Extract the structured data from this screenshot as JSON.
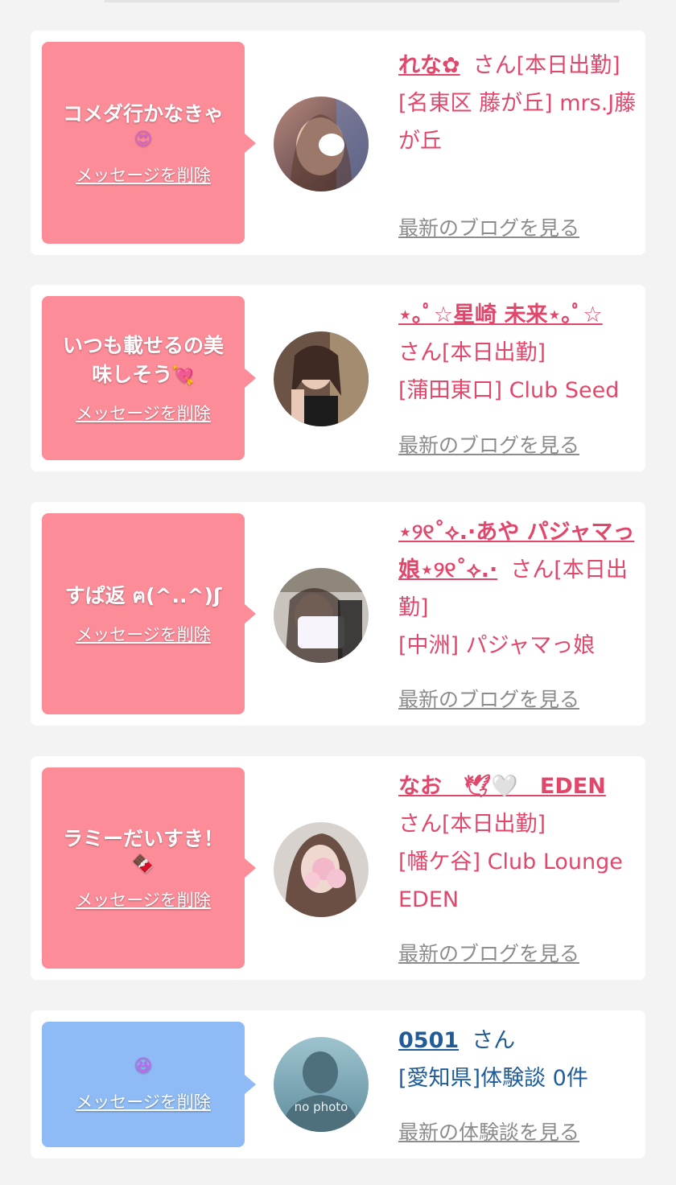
{
  "cards": [
    {
      "message": "コメダ行かなきゃ",
      "message_emoji": "😍",
      "delete_label": "メッセージを削除",
      "name": "れな✿",
      "suffix": "さん[本日出勤]",
      "shop": "[名東区 藤が丘] mrs.J藤が丘",
      "blog_label": "最新のブログを見る"
    },
    {
      "message": "いつも載せるの美味しそう",
      "message_emoji": "💘",
      "delete_label": "メッセージを削除",
      "name": "⋆｡ﾟ☆星崎 未来⋆｡ﾟ☆",
      "suffix": "さん[本日出勤]",
      "shop": "[蒲田東口] Club Seed",
      "blog_label": "最新のブログを見る"
    },
    {
      "message": "すぱ返 ฅ(^..^)ʃ",
      "message_emoji": "",
      "delete_label": "メッセージを削除",
      "name": "⋆୨୧˚⟡.·あや パジャマっ娘⋆୨୧˚⟡.·",
      "suffix": "さん[本日出勤]",
      "shop": "[中洲] パジャマっ娘",
      "blog_label": "最新のブログを見る"
    },
    {
      "message": "ラミーだいすき！",
      "message_emoji": "🍫",
      "delete_label": "メッセージを削除",
      "name": "なお　🕊🤍　EDEN",
      "suffix": "さん[本日出勤]",
      "shop": "[幡ケ谷] Club Lounge EDEN",
      "blog_label": "最新のブログを見る"
    },
    {
      "message": "",
      "message_emoji": "😆",
      "delete_label": "メッセージを削除",
      "name": "0501",
      "suffix": "さん",
      "shop": "[愛知県]体験談 0件",
      "blog_label": "最新の体験談を見る",
      "avatar_text": "no photo"
    }
  ],
  "colors": {
    "bubble_pink": "#fd8c99",
    "bubble_blue": "#8ebbf5",
    "name_pink": "#e0476b",
    "name_blue": "#1f5c99",
    "link_gray": "#8c8c8c"
  }
}
